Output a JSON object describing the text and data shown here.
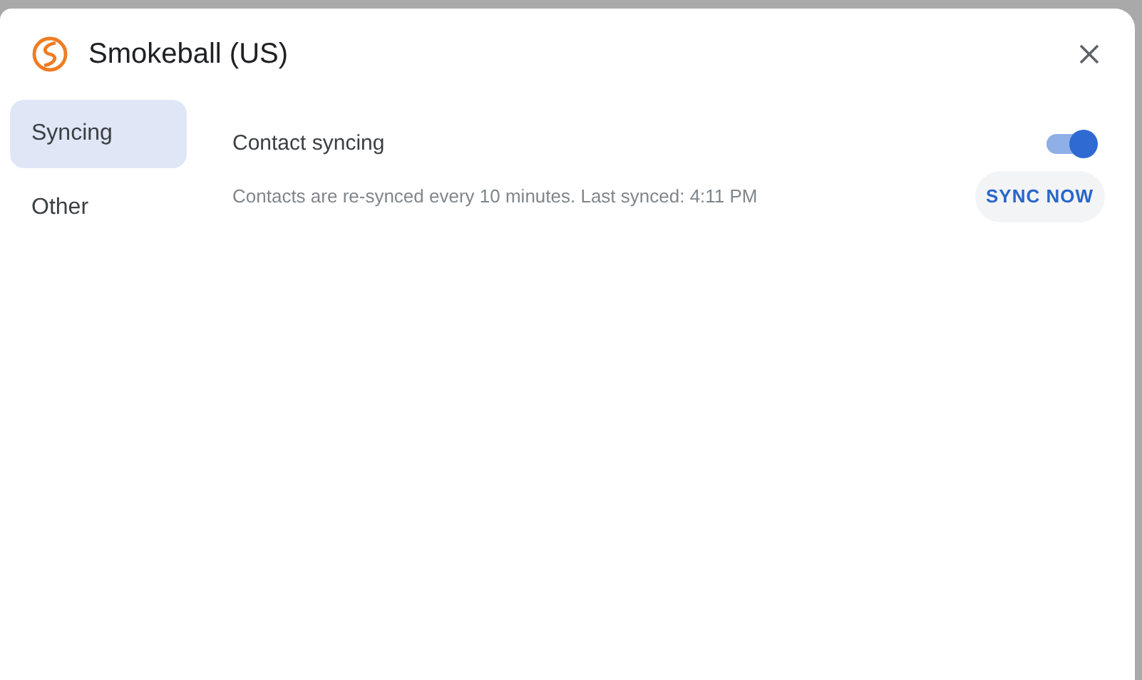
{
  "dialog": {
    "title": "Smokeball (US)"
  },
  "sidebar": {
    "items": [
      {
        "label": "Syncing",
        "selected": true
      },
      {
        "label": "Other",
        "selected": false
      }
    ]
  },
  "setting": {
    "label": "Contact syncing",
    "on": true,
    "description": "Contacts are re-synced every 10 minutes. Last synced: 4:11 PM",
    "button": "SYNC NOW"
  }
}
